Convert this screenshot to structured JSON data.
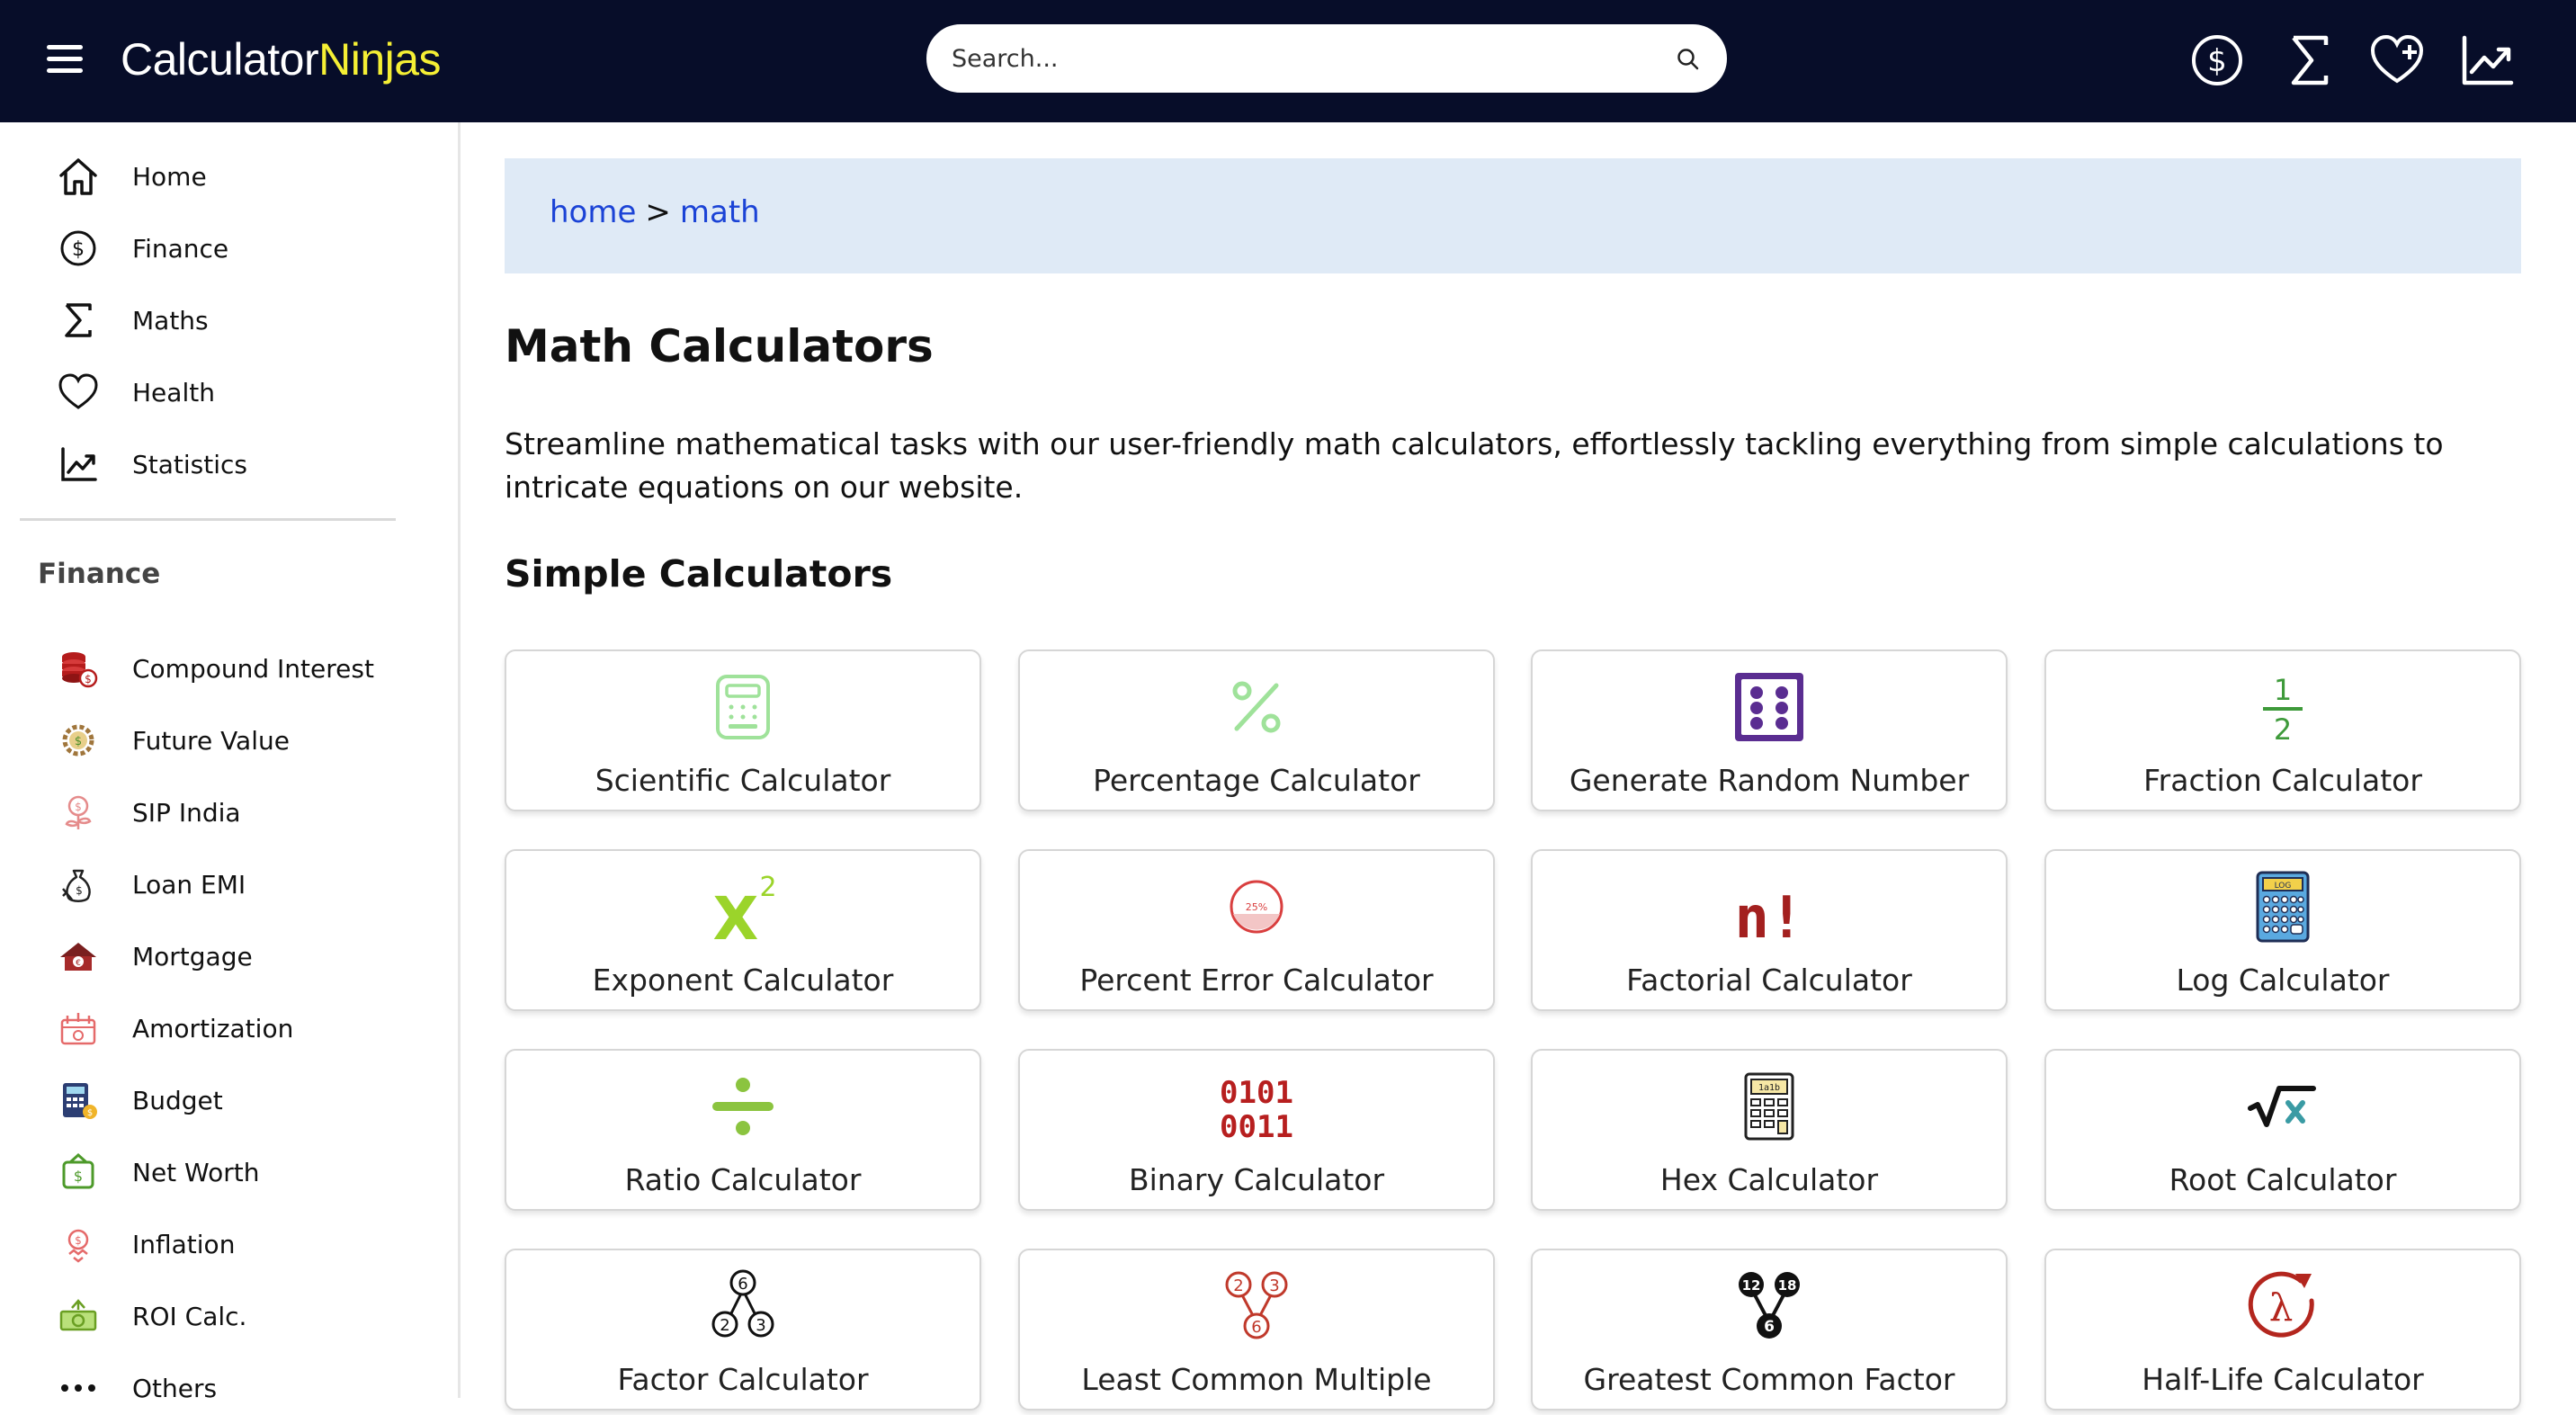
{
  "header": {
    "brand_part1": "Calculator",
    "brand_part2": "Ninjas",
    "search_placeholder": "Search...",
    "icons": [
      "dollar-circle-icon",
      "sigma-icon",
      "heart-plus-icon",
      "chart-line-icon"
    ]
  },
  "sidebar": {
    "nav": [
      {
        "label": "Home",
        "icon": "home-icon"
      },
      {
        "label": "Finance",
        "icon": "dollar-circle-icon"
      },
      {
        "label": "Maths",
        "icon": "sigma-icon"
      },
      {
        "label": "Health",
        "icon": "heart-icon"
      },
      {
        "label": "Statistics",
        "icon": "chart-line-icon"
      }
    ],
    "section_title": "Finance",
    "finance": [
      {
        "label": "Compound Interest",
        "icon": "coins-icon"
      },
      {
        "label": "Future Value",
        "icon": "money-gear-icon"
      },
      {
        "label": "SIP India",
        "icon": "plant-coin-icon"
      },
      {
        "label": "Loan EMI",
        "icon": "money-bag-icon"
      },
      {
        "label": "Mortgage",
        "icon": "house-icon"
      },
      {
        "label": "Amortization",
        "icon": "calendar-money-icon"
      },
      {
        "label": "Budget",
        "icon": "budget-calculator-icon"
      },
      {
        "label": "Net Worth",
        "icon": "wallet-icon"
      },
      {
        "label": "Inflation",
        "icon": "inflation-icon"
      },
      {
        "label": "ROI Calc.",
        "icon": "roi-icon"
      },
      {
        "label": "Others",
        "icon": "more-dots-icon"
      }
    ]
  },
  "breadcrumb": {
    "home": "home",
    "separator": ">",
    "current": "math"
  },
  "main": {
    "title": "Math Calculators",
    "description": "Streamline mathematical tasks with our user-friendly math calculators, effortlessly tackling everything from simple calculations to intricate equations on our website.",
    "section_title": "Simple Calculators",
    "cards": [
      {
        "label": "Scientific Calculator",
        "icon": "scientific-calculator-icon"
      },
      {
        "label": "Percentage Calculator",
        "icon": "percent-icon"
      },
      {
        "label": "Generate Random Number",
        "icon": "dice-icon"
      },
      {
        "label": "Fraction Calculator",
        "icon": "fraction-icon"
      },
      {
        "label": "Exponent Calculator",
        "icon": "exponent-icon"
      },
      {
        "label": "Percent Error Calculator",
        "icon": "percent-error-icon"
      },
      {
        "label": "Factorial Calculator",
        "icon": "factorial-icon"
      },
      {
        "label": "Log Calculator",
        "icon": "log-calculator-icon"
      },
      {
        "label": "Ratio Calculator",
        "icon": "division-icon"
      },
      {
        "label": "Binary Calculator",
        "icon": "binary-icon"
      },
      {
        "label": "Hex Calculator",
        "icon": "hex-calculator-icon"
      },
      {
        "label": "Root Calculator",
        "icon": "square-root-icon"
      },
      {
        "label": "Factor Calculator",
        "icon": "factor-tree-icon"
      },
      {
        "label": "Least Common Multiple",
        "icon": "lcm-tree-icon"
      },
      {
        "label": "Greatest Common Factor",
        "icon": "gcf-tree-icon"
      },
      {
        "label": "Half-Life Calculator",
        "icon": "half-life-icon"
      }
    ],
    "icon_texts": {
      "fraction_num": "1",
      "fraction_den": "2",
      "exp_base": "X",
      "exp_pow": "2",
      "pct_err": "25%",
      "factorial": "n!",
      "log": "LOG",
      "hex": "1a1b",
      "binary_1": "0101",
      "binary_2": "0011",
      "factor_top": "6",
      "factor_l": "2",
      "factor_r": "3",
      "lcm_l": "2",
      "lcm_r": "3",
      "lcm_bottom": "6",
      "gcf_l": "12",
      "gcf_r": "18",
      "gcf_bottom": "6",
      "lambda": "λ"
    }
  }
}
